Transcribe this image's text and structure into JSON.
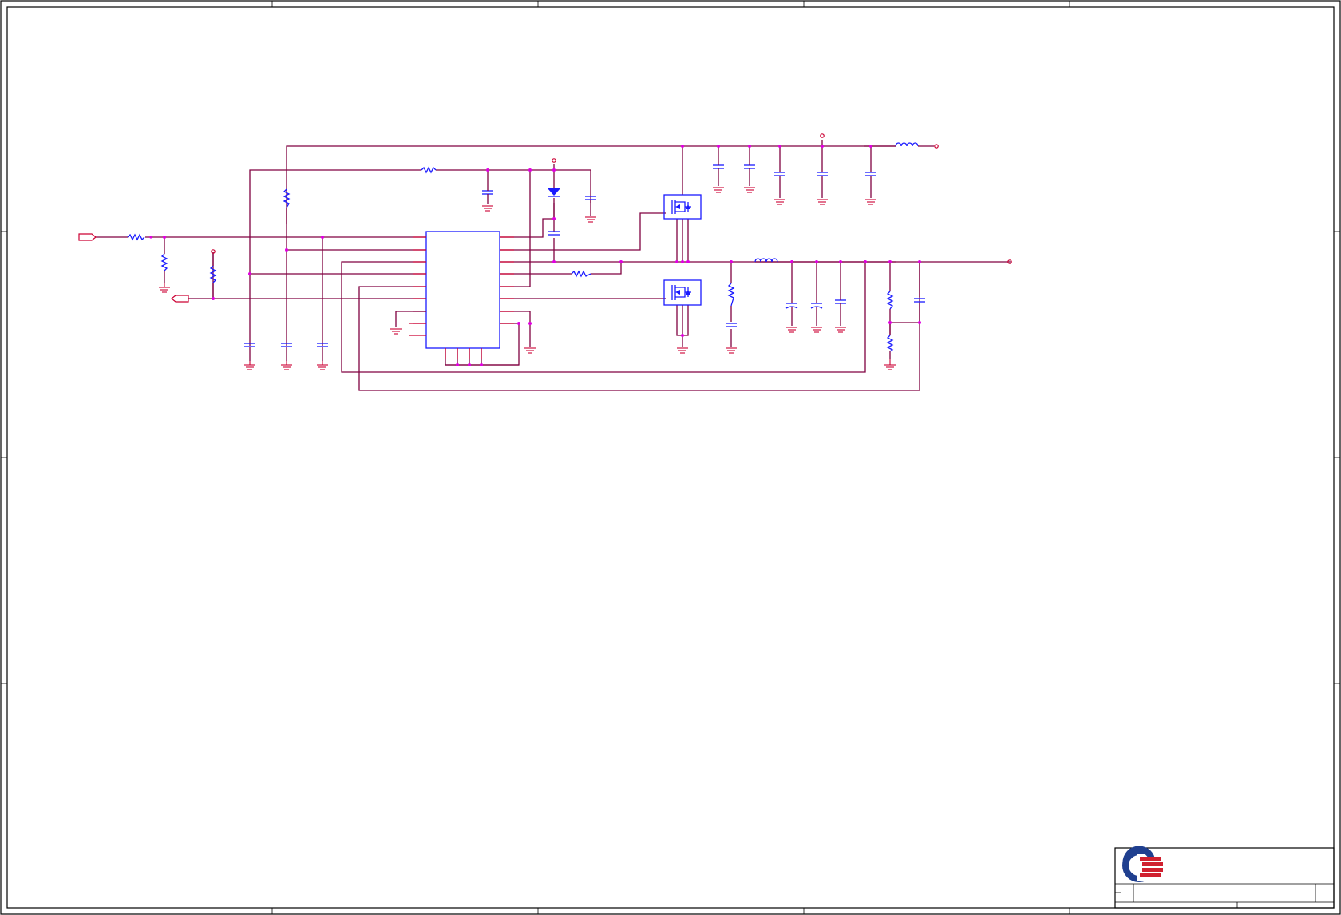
{
  "schematic": {
    "frame": {
      "zones_horizontal": 5,
      "zones_vertical": 4
    },
    "title_block": {
      "logo": "company-logo",
      "colors": {
        "logo_blue": "#1f3f8f",
        "logo_red": "#d0202f"
      }
    },
    "colors": {
      "wire": "#800040",
      "component": "#1a1aff",
      "pin_and_ground": "#cc0033",
      "junction": "#e000e0"
    }
  }
}
